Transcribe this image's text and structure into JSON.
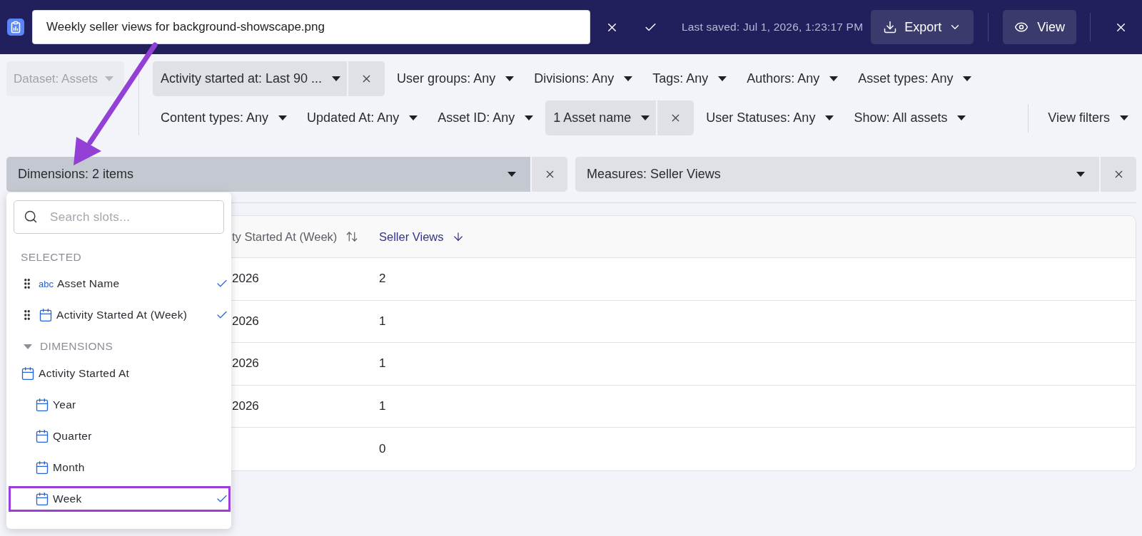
{
  "header": {
    "title_input": {
      "value": "Weekly seller views for background-showscape.png"
    },
    "last_saved": "Last saved: Jul 1, 2026, 1:23:17 PM",
    "export_button": {
      "label": "Export"
    },
    "view_button": {
      "label": "View"
    }
  },
  "dataset": {
    "label": "Dataset: Assets",
    "disabled": true
  },
  "filter_rows": [
    {
      "filters": [
        {
          "label": "Activity started at: Last 90 ...",
          "active": true
        },
        {
          "label": "User groups: Any",
          "active": false
        },
        {
          "label": "Divisions: Any",
          "active": false
        },
        {
          "label": "Tags: Any",
          "active": false
        },
        {
          "label": "Authors: Any",
          "active": false
        },
        {
          "label": "Asset types: Any",
          "active": false
        }
      ]
    },
    {
      "filters": [
        {
          "label": "Content types: Any",
          "active": false
        },
        {
          "label": "Updated At: Any",
          "active": false
        },
        {
          "label": "Asset ID: Any",
          "active": false
        },
        {
          "label": "1 Asset name",
          "active": true
        },
        {
          "label": "User Statuses: Any",
          "active": false
        },
        {
          "label": "Show: All assets",
          "active": false
        }
      ]
    }
  ],
  "view_filters": {
    "label": "View filters"
  },
  "dimensions": {
    "label": "Dimensions: 2 items",
    "open": true,
    "annotated": true
  },
  "measures": {
    "label": "Measures: Seller Views",
    "open": false
  },
  "table": {
    "columns": [
      {
        "label": "ty Started At (Week)",
        "sorted": false
      },
      {
        "label": "Seller Views",
        "sorted": true
      }
    ],
    "rows": [
      {
        "cells": [
          "2026",
          "2"
        ]
      },
      {
        "cells": [
          "2026",
          "1"
        ]
      },
      {
        "cells": [
          "2026",
          "1"
        ]
      },
      {
        "cells": [
          "2026",
          "1"
        ]
      },
      {
        "cells": [
          null,
          "0"
        ]
      }
    ]
  },
  "slot_picker": {
    "search": {
      "placeholder": "Search slots..."
    },
    "selected": {
      "title": "SELECTED",
      "items": [
        {
          "kind": "text",
          "badge": "abc",
          "label": "Asset Name",
          "checked": true,
          "highlighted": false
        },
        {
          "kind": "date",
          "label": "Activity Started At (Week)",
          "checked": true,
          "highlighted": false
        }
      ]
    },
    "dimensions": {
      "title": "DIMENSIONS",
      "expanded": true,
      "items": [
        {
          "kind": "date",
          "label": "Activity Started At",
          "checked": false,
          "highlighted": false,
          "children": [
            {
              "kind": "date",
              "label": "Year",
              "checked": false,
              "highlighted": false
            },
            {
              "kind": "date",
              "label": "Quarter",
              "checked": false,
              "highlighted": false
            },
            {
              "kind": "date",
              "label": "Month",
              "checked": false,
              "highlighted": false
            },
            {
              "kind": "date",
              "label": "Week",
              "checked": true,
              "highlighted": true
            }
          ]
        }
      ]
    }
  }
}
